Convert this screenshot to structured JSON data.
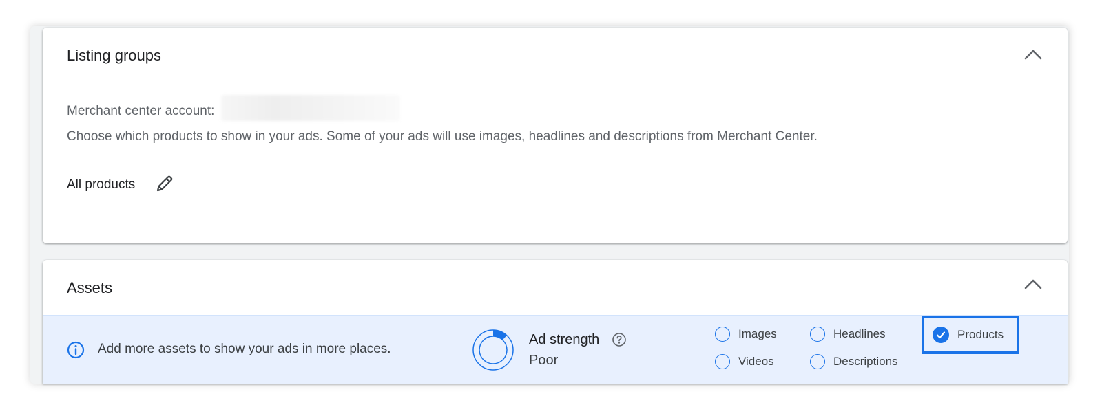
{
  "listing_groups": {
    "title": "Listing groups",
    "merchant_label": "Merchant center account:",
    "description": "Choose which products to show in your ads. Some of your ads will use images, headlines and descriptions from Merchant Center.",
    "selection": "All products"
  },
  "assets": {
    "title": "Assets",
    "info_text": "Add more assets to show your ads in more places.",
    "ad_strength_label": "Ad strength",
    "ad_strength_value": "Poor",
    "ad_strength_fraction": 0.12,
    "options": [
      {
        "label": "Images",
        "checked": false
      },
      {
        "label": "Headlines",
        "checked": false
      },
      {
        "label": "Products",
        "checked": true
      },
      {
        "label": "Videos",
        "checked": false
      },
      {
        "label": "Descriptions",
        "checked": false
      }
    ]
  },
  "colors": {
    "accent": "#1a73e8",
    "banner_bg": "#e8f0fe"
  }
}
